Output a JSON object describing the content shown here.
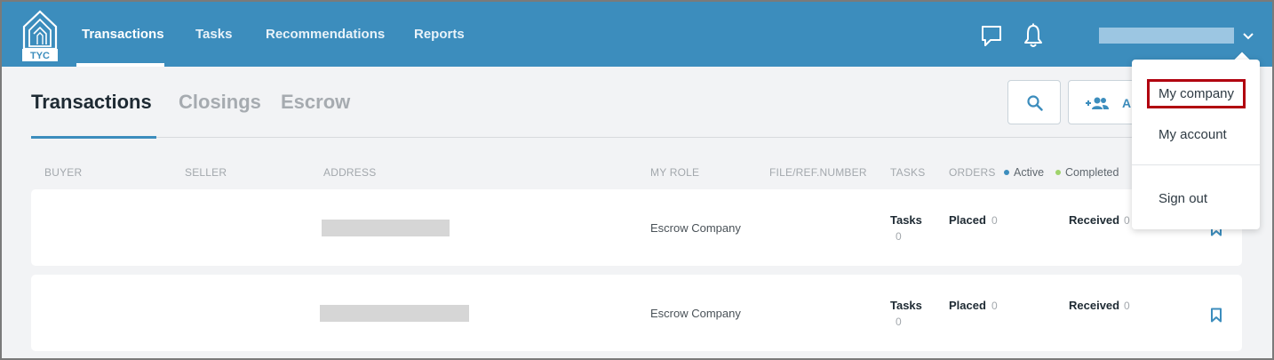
{
  "brand": {
    "logo_text": "TYC"
  },
  "nav": {
    "items": [
      "Transactions",
      "Tasks",
      "Recommendations",
      "Reports"
    ],
    "active": "Transactions"
  },
  "header_icons": [
    "chat-icon",
    "bell-icon",
    "chevron-down-icon"
  ],
  "tabs": {
    "items": [
      "Transactions",
      "Closings",
      "Escrow"
    ],
    "active": "Transactions"
  },
  "toolbar": {
    "add_label": "A"
  },
  "columns": {
    "buyer": "BUYER",
    "seller": "SELLER",
    "address": "ADDRESS",
    "my_role": "MY ROLE",
    "file_ref": "FILE/REF.NUMBER",
    "tasks": "TASKS",
    "orders": "ORDERS"
  },
  "legend": {
    "active": "Active",
    "completed": "Completed"
  },
  "rows": [
    {
      "role": "Escrow Company",
      "tasks_label": "Tasks",
      "tasks_count": "0",
      "placed_label": "Placed",
      "placed_count": "0",
      "received_label": "Received",
      "received_count": "0"
    },
    {
      "role": "Escrow Company",
      "tasks_label": "Tasks",
      "tasks_count": "0",
      "placed_label": "Placed",
      "placed_count": "0",
      "received_label": "Received",
      "received_count": "0"
    }
  ],
  "user_menu": {
    "items": [
      "My company",
      "My account",
      "Sign out"
    ],
    "highlighted": "My company"
  },
  "colors": {
    "topbar": "#3c8dbd",
    "accent": "#3c8dbd",
    "active_dot": "#3c8dbd",
    "completed_dot": "#9fd36b",
    "highlight": "#b1000f"
  }
}
